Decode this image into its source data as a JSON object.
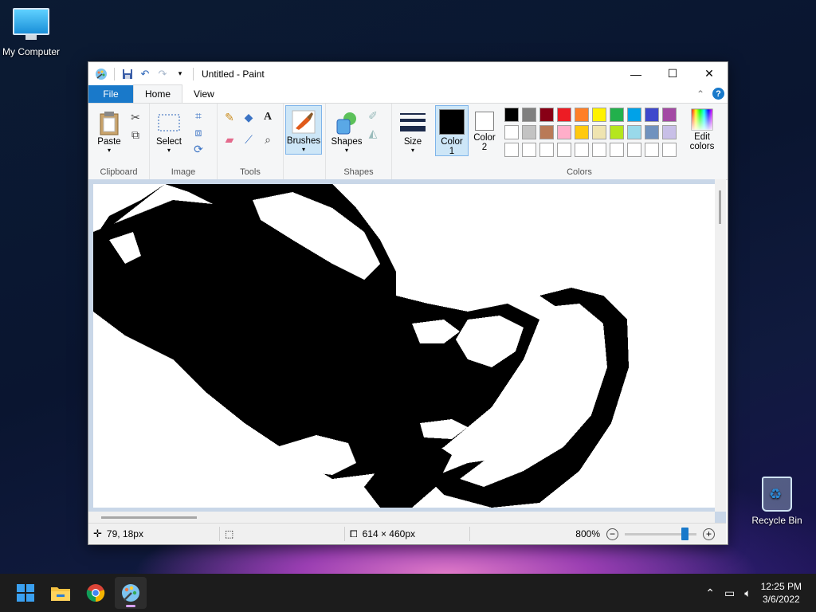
{
  "desktop": {
    "icons": [
      {
        "label": "My Computer",
        "icon": "computer-icon"
      },
      {
        "label": "Recycle Bin",
        "icon": "recycle-bin-icon"
      }
    ]
  },
  "window": {
    "title": "Untitled - Paint",
    "quick_access": [
      "paint-app-icon",
      "save-icon",
      "undo-icon",
      "redo-icon",
      "customize-dropdown-icon"
    ],
    "controls": {
      "minimize": "—",
      "maximize": "☐",
      "close": "✕"
    }
  },
  "ribbon_tabs": {
    "file": "File",
    "home": "Home",
    "view": "View",
    "help": "?",
    "collapse": "⌃"
  },
  "ribbon": {
    "clipboard": {
      "label": "Clipboard",
      "paste": "Paste"
    },
    "image": {
      "label": "Image",
      "select": "Select"
    },
    "tools": {
      "label": "Tools"
    },
    "brushes": {
      "label": "Brushes"
    },
    "shapes": {
      "label": "Shapes",
      "shapes_btn": "Shapes"
    },
    "size": {
      "label": "Size"
    },
    "colors": {
      "label": "Colors",
      "color1": "Color 1",
      "color1_line1": "Color",
      "color1_line2": "1",
      "color2_line1": "Color",
      "color2_line2": "2",
      "edit_line1": "Edit",
      "edit_line2": "colors",
      "color1_value": "#000000",
      "color2_value": "#ffffff",
      "palette_row1": [
        "#000000",
        "#7f7f7f",
        "#880015",
        "#ed1c24",
        "#ff7f27",
        "#fff200",
        "#22b14c",
        "#00a2e8",
        "#3f48cc",
        "#a349a4"
      ],
      "palette_row2": [
        "#ffffff",
        "#c3c3c3",
        "#b97a57",
        "#ffaec9",
        "#ffc90e",
        "#efe4b0",
        "#b5e61d",
        "#99d9ea",
        "#7092be",
        "#c8bfe7"
      ],
      "palette_row3": [
        "#ffffff",
        "#ffffff",
        "#ffffff",
        "#ffffff",
        "#ffffff",
        "#ffffff",
        "#ffffff",
        "#ffffff",
        "#ffffff",
        "#ffffff"
      ]
    }
  },
  "status": {
    "cursor_pos": "79, 18px",
    "image_size": "614 × 460px",
    "zoom": "800%",
    "zoom_level_fraction": 0.83
  },
  "taskbar": {
    "apps": [
      "start-icon",
      "file-explorer-icon",
      "chrome-icon",
      "paint-icon"
    ],
    "time": "12:25 PM",
    "date": "3/6/2022"
  }
}
